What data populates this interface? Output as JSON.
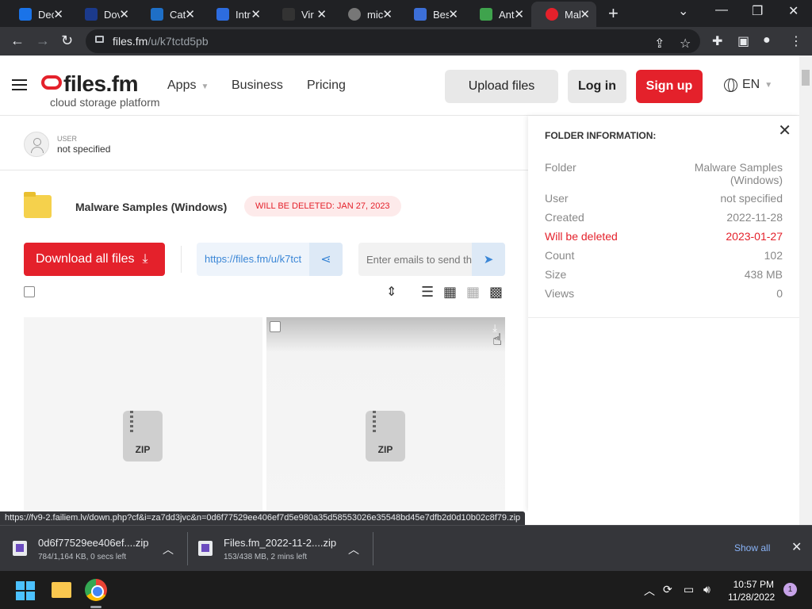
{
  "browser": {
    "tabs": [
      {
        "title": "Dec",
        "color": "#1a73e8"
      },
      {
        "title": "Dov",
        "color": "#1b3a8c"
      },
      {
        "title": "Cat",
        "color": "#1e6fc7"
      },
      {
        "title": "Intr",
        "color": "#2d6cdf"
      },
      {
        "title": "Vir",
        "color": "#333333"
      },
      {
        "title": "mic",
        "color": "#777777"
      },
      {
        "title": "Bes",
        "color": "#3c6fd8"
      },
      {
        "title": "Ant",
        "color": "#3fa34d"
      },
      {
        "title": "Mal",
        "color": "#e4212b"
      }
    ],
    "url_host": "files.fm",
    "url_path": "/u/k7tctd5pb"
  },
  "site": {
    "logo_text": "files.fm",
    "logo_sub": "cloud storage platform",
    "nav": {
      "apps": "Apps",
      "business": "Business",
      "pricing": "Pricing"
    },
    "upload_label": "Upload files",
    "login_label": "Log in",
    "signup_label": "Sign up",
    "lang": "EN"
  },
  "owner": {
    "label": "USER",
    "value": "not specified"
  },
  "folder": {
    "name": "Malware Samples (Windows)",
    "deletion_badge": "WILL BE DELETED: JAN 27, 2023",
    "download_all_label": "Download all files",
    "share_link": "https://files.fm/u/k7tct",
    "email_placeholder": "Enter emails to send th"
  },
  "files": [
    {
      "type_label": "ZIP"
    },
    {
      "type_label": "ZIP"
    }
  ],
  "info_panel": {
    "heading": "FOLDER INFORMATION:",
    "rows": [
      {
        "key": "Folder",
        "value": "Malware Samples (Windows)"
      },
      {
        "key": "User",
        "value": "not specified"
      },
      {
        "key": "Created",
        "value": "2022-11-28"
      },
      {
        "key": "Will be deleted",
        "value": "2023-01-27"
      },
      {
        "key": "Count",
        "value": "102"
      },
      {
        "key": "Size",
        "value": "438 MB"
      },
      {
        "key": "Views",
        "value": "0"
      }
    ]
  },
  "status_url": "https://fv9-2.failiem.lv/down.php?cf&i=za7dd3jvc&n=0d6f77529ee406ef7d5e980a35d58553026e35548bd45e7dfb2d0d10b02c8f79.zip",
  "downloads": {
    "items": [
      {
        "name": "0d6f77529ee406ef....zip",
        "status": "784/1,164 KB, 0 secs left"
      },
      {
        "name": "Files.fm_2022-11-2....zip",
        "status": "153/438 MB, 2 mins left"
      }
    ],
    "show_all_label": "Show all"
  },
  "taskbar": {
    "time": "10:57 PM",
    "date": "11/28/2022",
    "notification_count": "1"
  }
}
